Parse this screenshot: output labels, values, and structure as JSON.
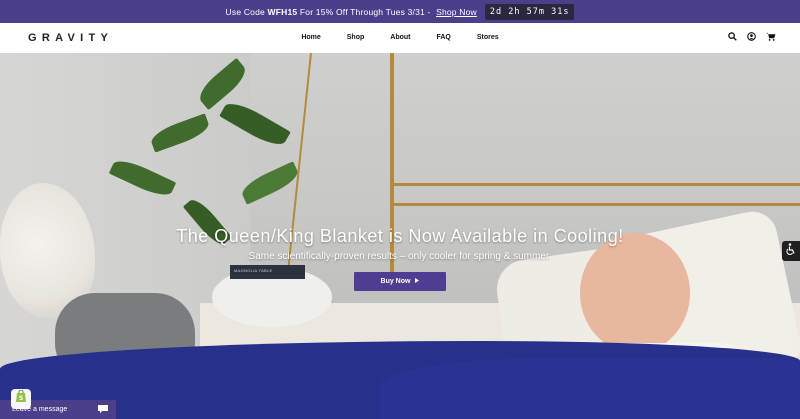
{
  "announcement": {
    "prefix": "Use Code",
    "code": "WFH15",
    "suffix": "For 15% Off Through Tues 3/31 -",
    "link": "Shop Now",
    "countdown": "2d 2h 57m 31s"
  },
  "header": {
    "logo": "GRAVITY",
    "nav": [
      "Home",
      "Shop",
      "About",
      "FAQ",
      "Stores"
    ],
    "icons": [
      "search-icon",
      "account-icon",
      "cart-icon"
    ]
  },
  "hero": {
    "title": "The Queen/King Blanket is Now Available in Cooling!",
    "subtitle": "Same scientifically-proven results – only cooler for spring & summer.",
    "button": "Buy Now",
    "book_text": "MAGNOLIA TABLE"
  },
  "widgets": {
    "chat_label": "Leave a message"
  },
  "colors": {
    "brand": "#4b3f8c",
    "button": "#4e3d91",
    "blanket": "#27308a"
  }
}
